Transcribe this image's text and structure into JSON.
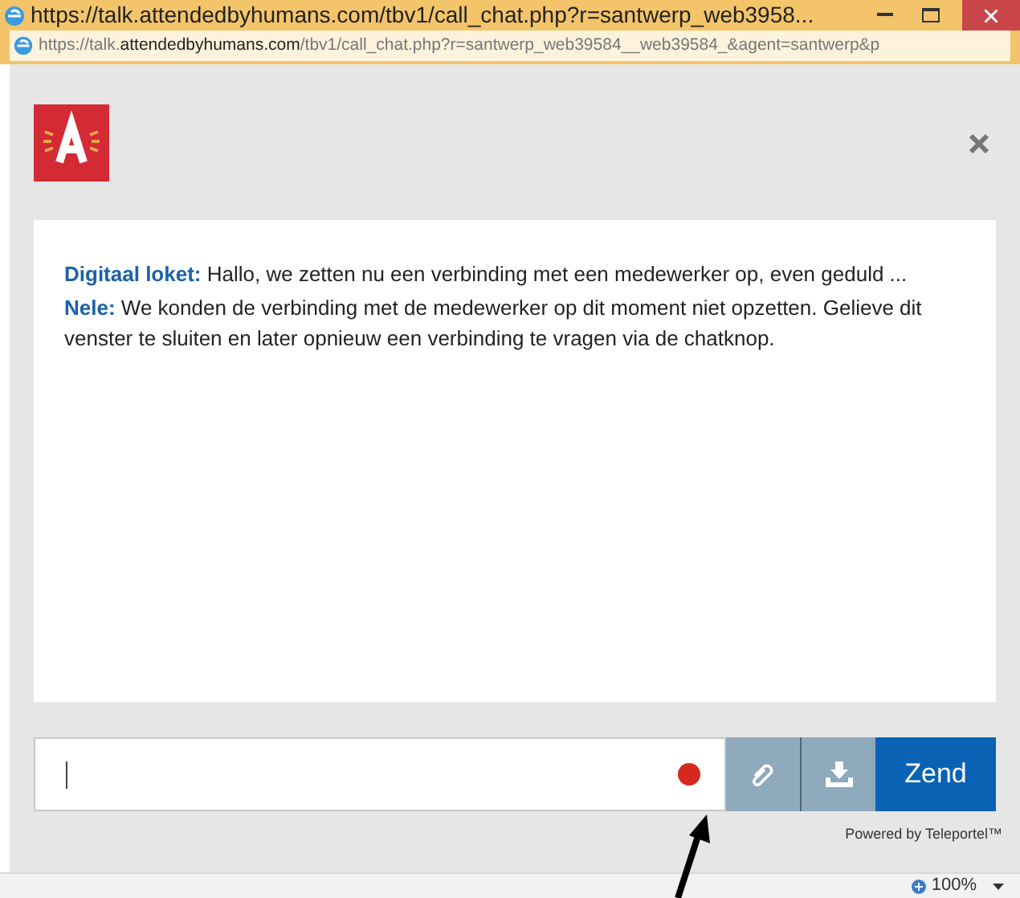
{
  "window": {
    "title": "https://talk.attendedbyhumans.com/tbv1/call_chat.php?r=santwerp_web3958..."
  },
  "address_bar": {
    "url": "https://talk.**attendedbyhumans.com**/tbv1/call_chat.php?r=santwerp_web39584__web39584_&agent=santwerp&p"
  },
  "chat": {
    "messages": [
      {
        "text": "**Digitaal loket:** Hallo, we zetten nu een verbinding met een medewerker op, even geduld ..."
      },
      {
        "text": "**Nele:** We konden de verbinding met de medewerker op dit moment niet opzetten. Gelieve dit venster te sluiten en later opnieuw een verbinding te vragen via de chatknop."
      }
    ],
    "send_button": "Zend",
    "powered_by": "Powered by Teleportel™"
  },
  "status_bar": {
    "zoom": "100%"
  }
}
